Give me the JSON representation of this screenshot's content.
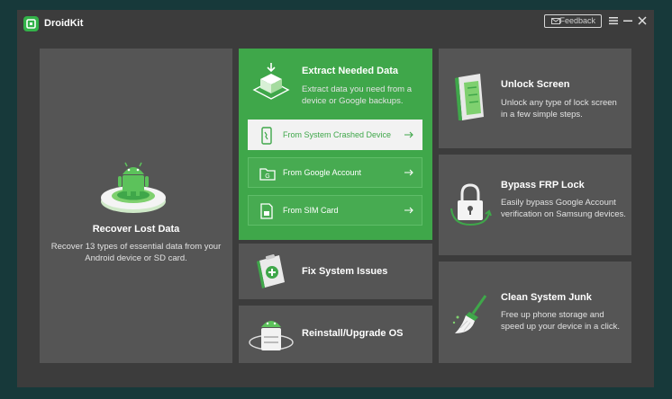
{
  "app": {
    "name": "DroidKit"
  },
  "titlebar": {
    "feedback_label": "Feedback"
  },
  "recover": {
    "title": "Recover Lost Data",
    "description": "Recover 13 types of essential data from your Android device or SD card."
  },
  "extract": {
    "title": "Extract Needed Data",
    "description": "Extract data you need from a device or Google backups.",
    "options": [
      {
        "label": "From System Crashed Device"
      },
      {
        "label": "From Google Account"
      },
      {
        "label": "From SIM Card"
      }
    ]
  },
  "fix": {
    "title": "Fix System Issues"
  },
  "reinstall": {
    "title": "Reinstall/Upgrade OS"
  },
  "unlock": {
    "title": "Unlock Screen",
    "description": "Unlock any type of lock screen in a few simple steps."
  },
  "frp": {
    "title": "Bypass FRP Lock",
    "description": "Easily bypass Google Account verification on Samsung devices."
  },
  "clean": {
    "title": "Clean System Junk",
    "description": "Free up phone storage and speed up your device in a click."
  },
  "colors": {
    "accent": "#3fa74a",
    "tile": "#555555",
    "window": "#3c3c3c",
    "backdrop": "#17393a"
  }
}
